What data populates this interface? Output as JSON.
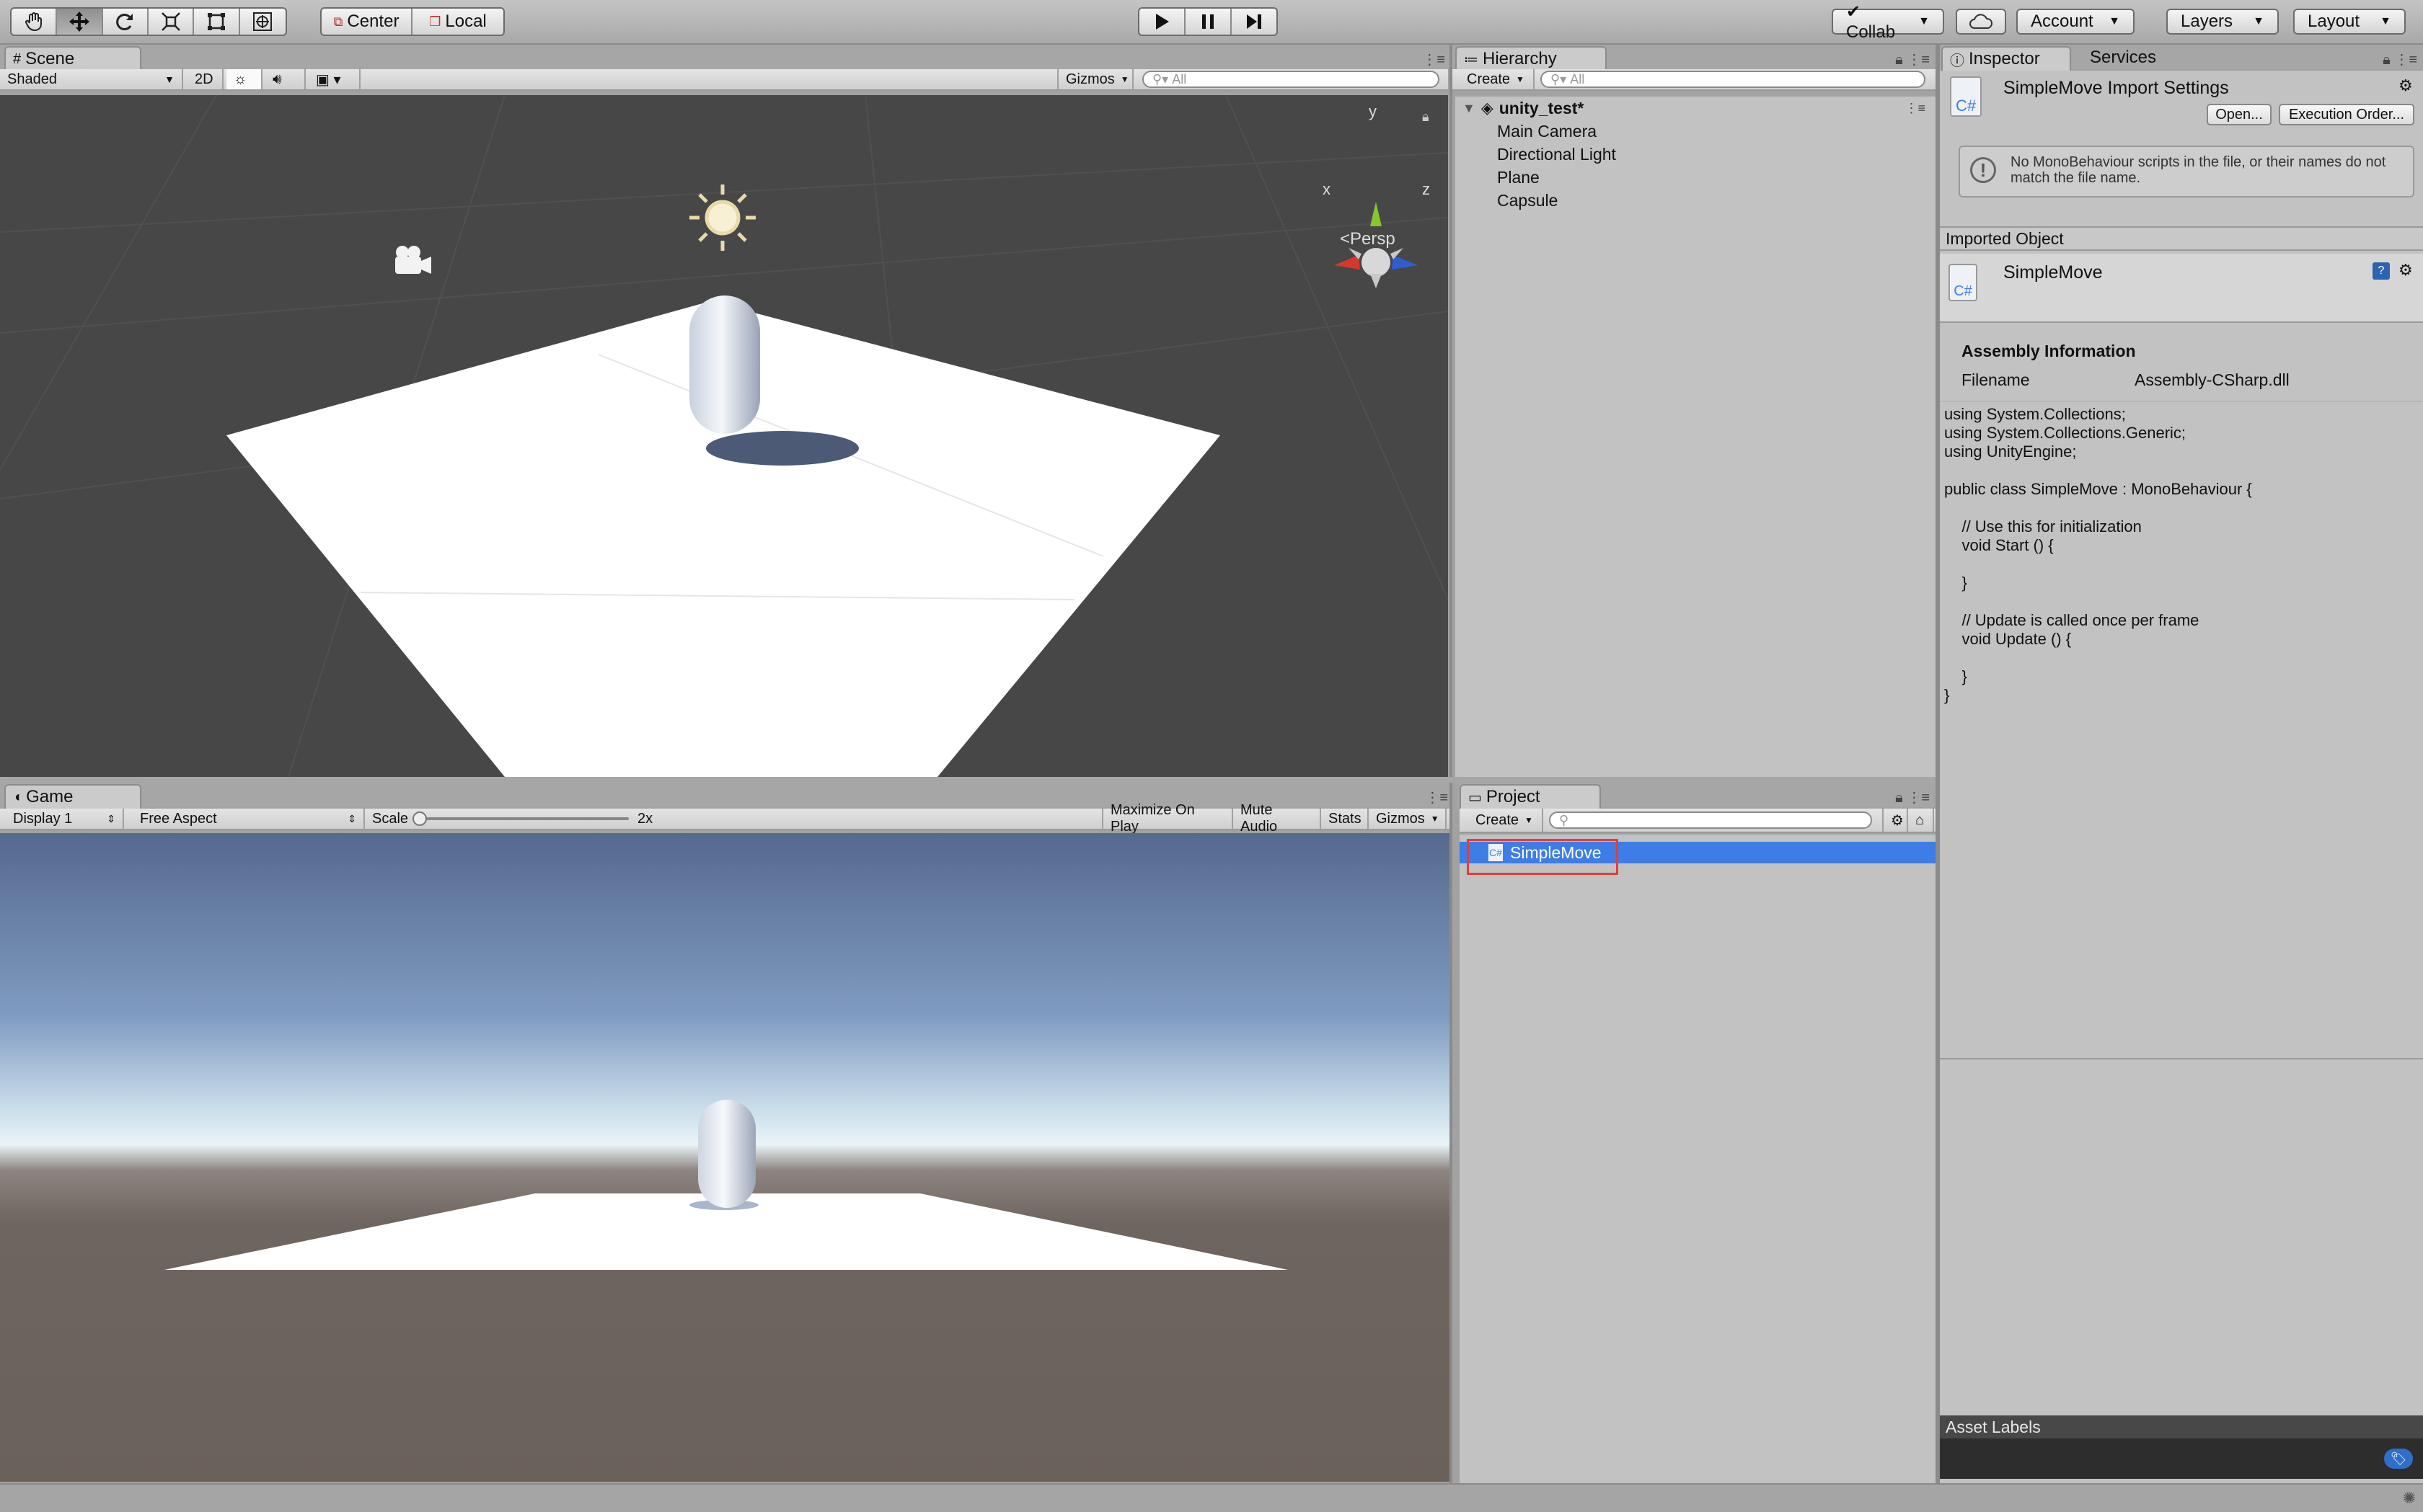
{
  "toolbar": {
    "tools": [
      "hand-tool",
      "move-tool",
      "rotate-tool",
      "scale-tool",
      "rect-tool",
      "transform-tool"
    ],
    "pivot_label": "Center",
    "space_label": "Local",
    "play_icons": [
      "play",
      "pause",
      "step"
    ],
    "collab_label": "Collab",
    "account_label": "Account",
    "layers_label": "Layers",
    "layout_label": "Layout"
  },
  "scene": {
    "tab": "Scene",
    "shading": "Shaded",
    "mode2d": "2D",
    "gizmos": "Gizmos",
    "search_placeholder": "All",
    "persp": "Persp",
    "axis": {
      "x": "x",
      "y": "y",
      "z": "z"
    }
  },
  "game": {
    "tab": "Game",
    "display": "Display 1",
    "aspect": "Free Aspect",
    "scale_label": "Scale",
    "scale_value": "2x",
    "maximize": "Maximize On Play",
    "mute": "Mute Audio",
    "stats": "Stats",
    "gizmos": "Gizmos"
  },
  "hierarchy": {
    "tab": "Hierarchy",
    "create": "Create",
    "search_placeholder": "All",
    "scene_name": "unity_test*",
    "items": [
      "Main Camera",
      "Directional Light",
      "Plane",
      "Capsule"
    ]
  },
  "project": {
    "tab": "Project",
    "create": "Create",
    "items": [
      "SimpleMove"
    ],
    "selected_color": "#3e7de5"
  },
  "inspector": {
    "tabs": [
      "Inspector",
      "Services"
    ],
    "title": "SimpleMove Import Settings",
    "open_button": "Open...",
    "exec_button": "Execution Order...",
    "warning": "No MonoBehaviour scripts in the file, or their names do not match the file name.",
    "imported_header": "Imported Object",
    "object_name": "SimpleMove",
    "assembly_header": "Assembly Information",
    "filename_label": "Filename",
    "filename_value": "Assembly-CSharp.dll",
    "code": "using System.Collections;\nusing System.Collections.Generic;\nusing UnityEngine;\n\npublic class SimpleMove : MonoBehaviour {\n\n\t// Use this for initialization\n\tvoid Start () {\n\t\t\n\t}\n\t\n\t// Update is called once per frame\n\tvoid Update () {\n\t\t\n\t}\n}",
    "asset_labels": "Asset Labels"
  }
}
